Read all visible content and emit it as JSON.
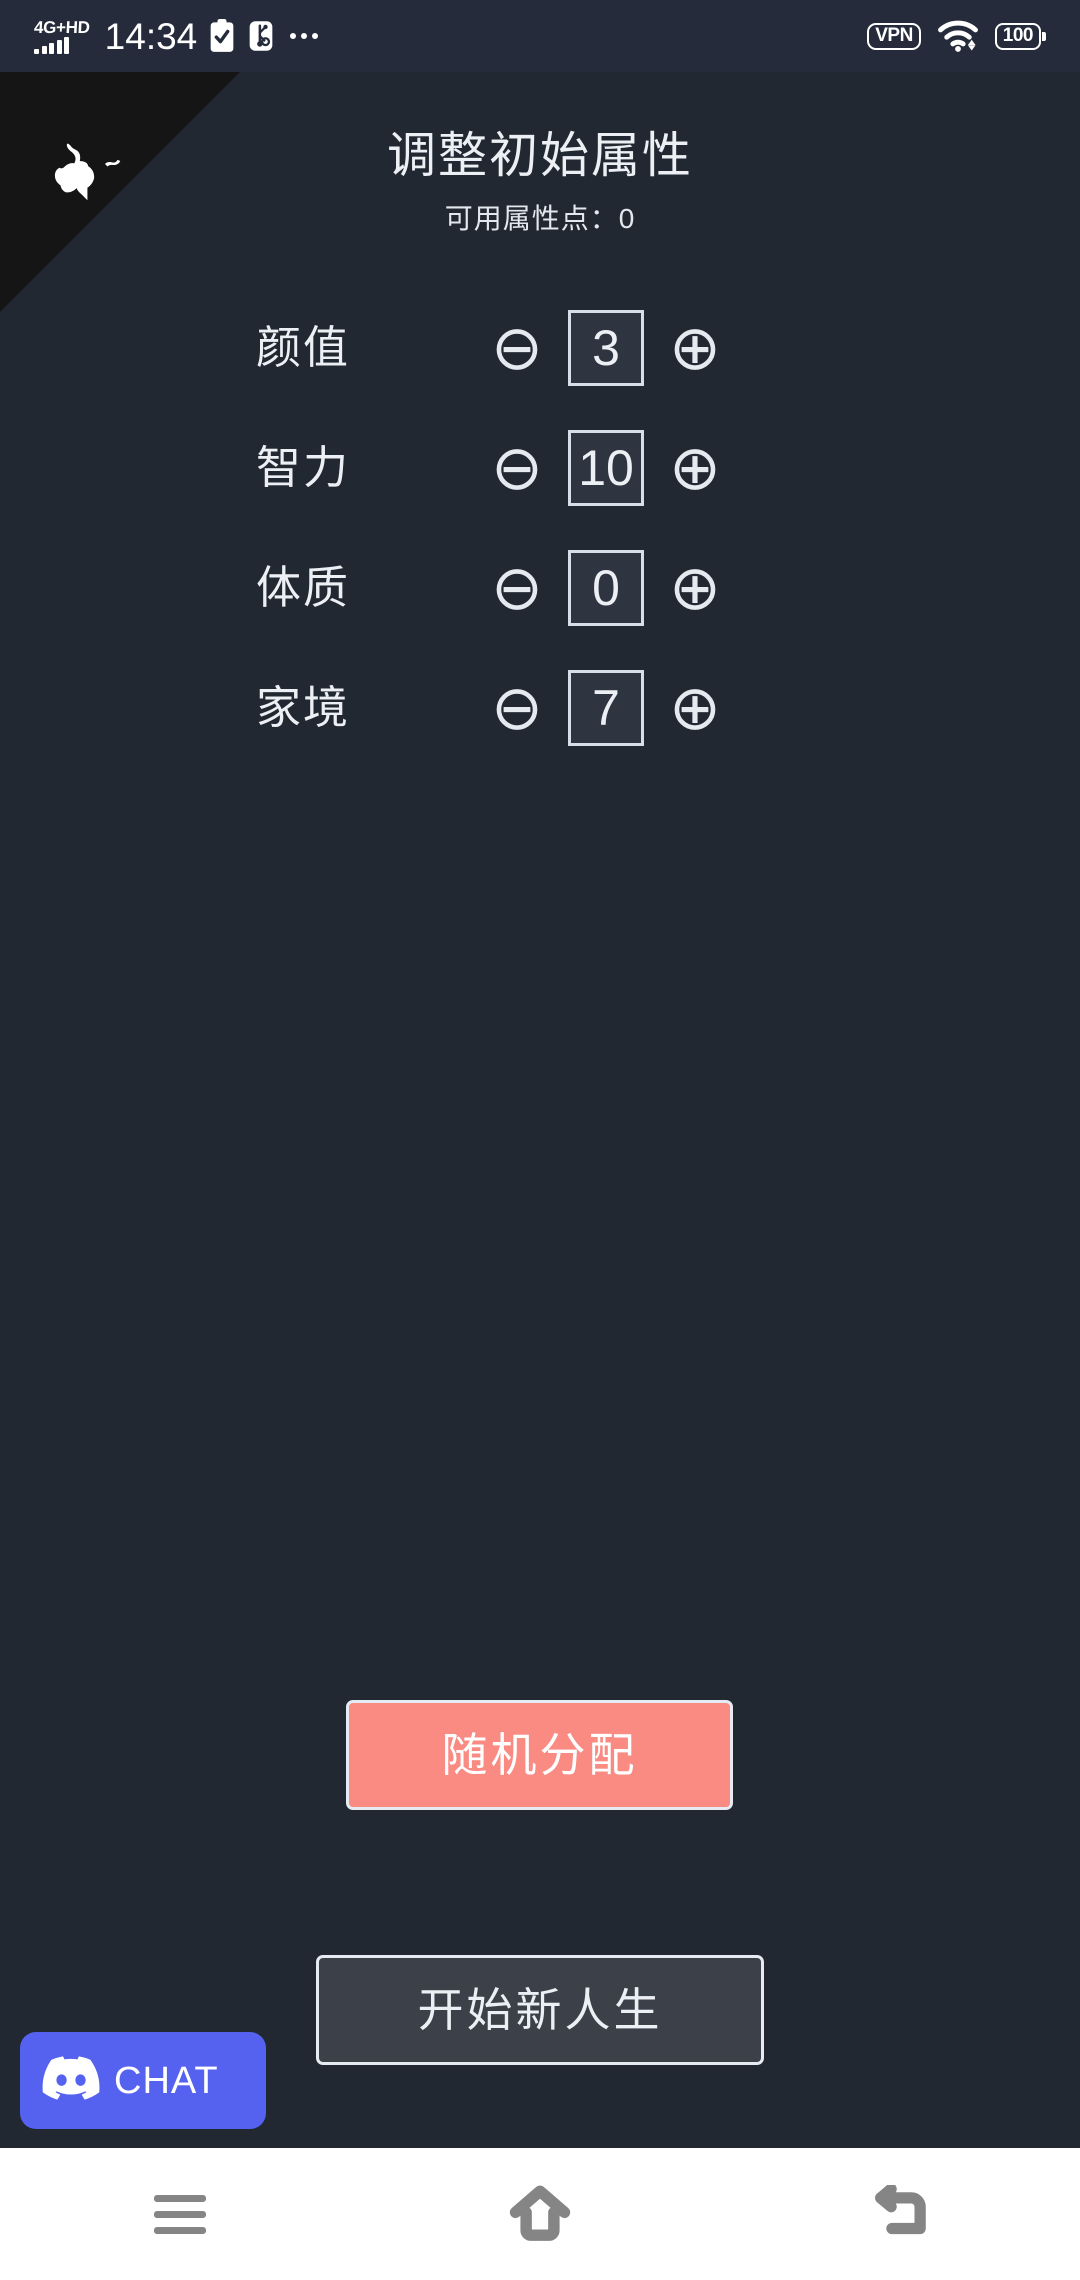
{
  "status_bar": {
    "network_label": "4G+HD",
    "signal_icon": "signal-bars-icon",
    "time": "14:34",
    "clipboard_icon": "clipboard-check-icon",
    "usb_debug_icon": "usb-debug-icon",
    "overflow_icon": "more-dots-icon",
    "vpn_label": "VPN",
    "wifi_icon": "wifi-icon",
    "battery_level": "100"
  },
  "github_corner": {
    "icon": "github-octocat-icon"
  },
  "header": {
    "title": "调整初始属性",
    "points_label": "可用属性点：0"
  },
  "attributes": [
    {
      "label": "颜值",
      "value": "3",
      "decrease": "⊖",
      "increase": "⊕"
    },
    {
      "label": "智力",
      "value": "10",
      "decrease": "⊖",
      "increase": "⊕"
    },
    {
      "label": "体质",
      "value": "0",
      "decrease": "⊖",
      "increase": "⊕"
    },
    {
      "label": "家境",
      "value": "7",
      "decrease": "⊖",
      "increase": "⊕"
    }
  ],
  "actions": {
    "random_label": "随机分配",
    "start_label": "开始新人生"
  },
  "discord": {
    "label": "CHAT",
    "icon": "discord-logo-icon"
  },
  "nav_bar": {
    "recents_icon": "menu-recents-icon",
    "home_icon": "home-icon",
    "back_icon": "back-arrow-icon"
  },
  "colors": {
    "background": "#222831",
    "status_bar": "#252b3b",
    "accent_random": "#f98b83",
    "discord_blurple": "#5562f0",
    "text_primary": "#eceff4",
    "github_corner": "#151515",
    "value_box_fill": "#2e3440",
    "start_button_fill": "#3b4049",
    "nav_bar": "#ffffff"
  }
}
